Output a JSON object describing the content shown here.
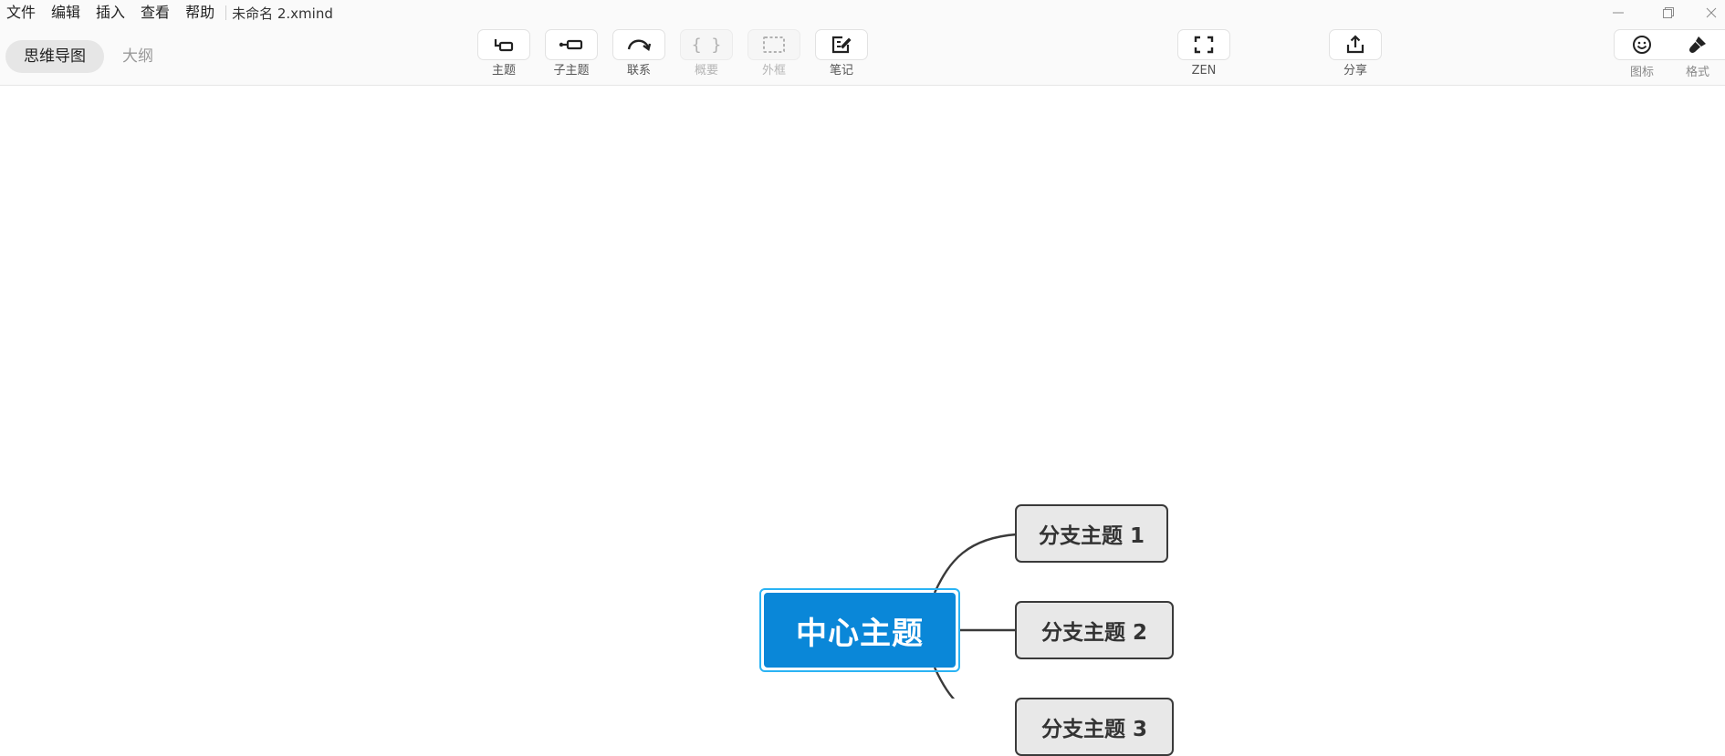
{
  "menu": {
    "items": [
      "文件",
      "编辑",
      "插入",
      "查看",
      "帮助"
    ],
    "file_title": "未命名 2.xmind"
  },
  "window": {
    "minimize": "—",
    "restore": "❐",
    "close": "✕"
  },
  "view_switch": {
    "mindmap": "思维导图",
    "outline": "大纲"
  },
  "toolbar": {
    "topic": "主题",
    "subtopic": "子主题",
    "relationship": "联系",
    "summary": "概要",
    "boundary": "外框",
    "note": "笔记",
    "zen": "ZEN",
    "share": "分享",
    "icon": "图标",
    "format": "格式"
  },
  "map": {
    "central": "中心主题",
    "branches": [
      "分支主题 1",
      "分支主题 2",
      "分支主题 3"
    ]
  },
  "colors": {
    "central_fill": "#0a87d8",
    "selection_border": "#2ab3f4",
    "branch_fill": "#e8e8e8",
    "line": "#3a3a3a"
  }
}
